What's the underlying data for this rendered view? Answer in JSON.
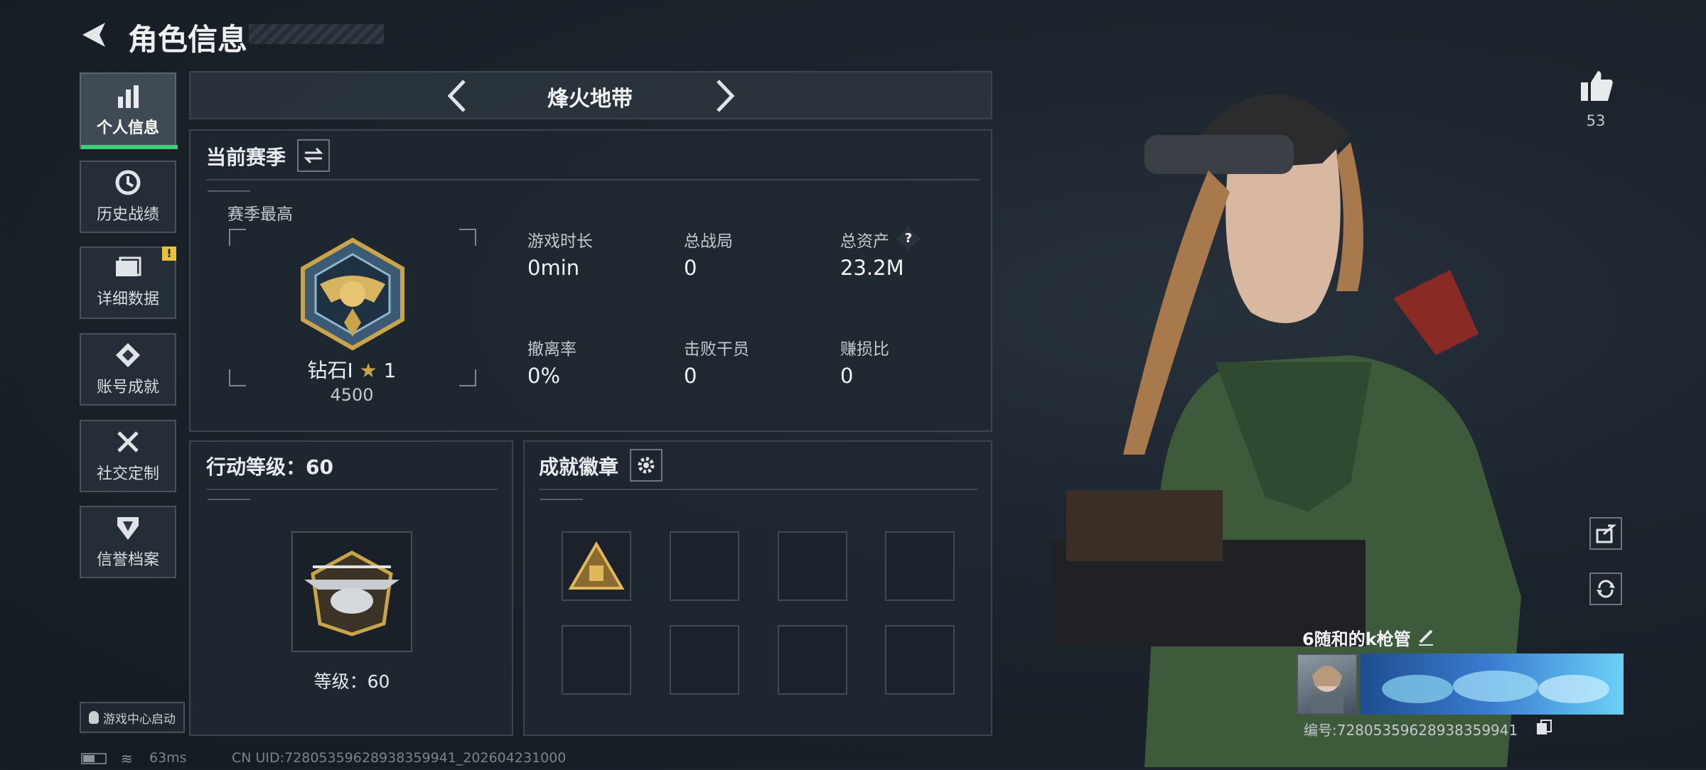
{
  "header": {
    "title": "角色信息"
  },
  "sidebar": {
    "items": [
      {
        "label": "个人信息",
        "icon": "bar-chart-icon",
        "active": true
      },
      {
        "label": "历史战绩",
        "icon": "history-icon"
      },
      {
        "label": "详细数据",
        "icon": "folder-icon",
        "alert": "!"
      },
      {
        "label": "账号成就",
        "icon": "achievement-icon"
      },
      {
        "label": "社交定制",
        "icon": "tools-icon"
      },
      {
        "label": "信誉档案",
        "icon": "credit-icon"
      }
    ],
    "game_center": "游戏中心启动"
  },
  "mode_selector": {
    "label": "烽火地带"
  },
  "season": {
    "title": "当前赛季",
    "best_label": "赛季最高",
    "rank_name": "钻石I",
    "rank_stars": "1",
    "rank_points": "4500",
    "stats": [
      {
        "label": "游戏时长",
        "value": "0min"
      },
      {
        "label": "总战局",
        "value": "0"
      },
      {
        "label": "总资产",
        "value": "23.2M",
        "help": "?"
      },
      {
        "label": "撤离率",
        "value": "0%"
      },
      {
        "label": "击败干员",
        "value": "0"
      },
      {
        "label": "赚损比",
        "value": "0"
      }
    ]
  },
  "action_level": {
    "title": "行动等级：60",
    "level_text": "等级：60"
  },
  "badges": {
    "title": "成就徽章"
  },
  "likes": {
    "count": "53"
  },
  "player": {
    "name": "6随和的k枪管",
    "id_line": "编号:728053596289383599​41"
  },
  "status_bar": {
    "ping": "63ms",
    "uid": "CN UID:7280535962893835994​1_202604231000"
  },
  "colors": {
    "accent_green": "#3ecf7a",
    "alert_yellow": "#e8c23a",
    "gold": "#c9a44a"
  }
}
